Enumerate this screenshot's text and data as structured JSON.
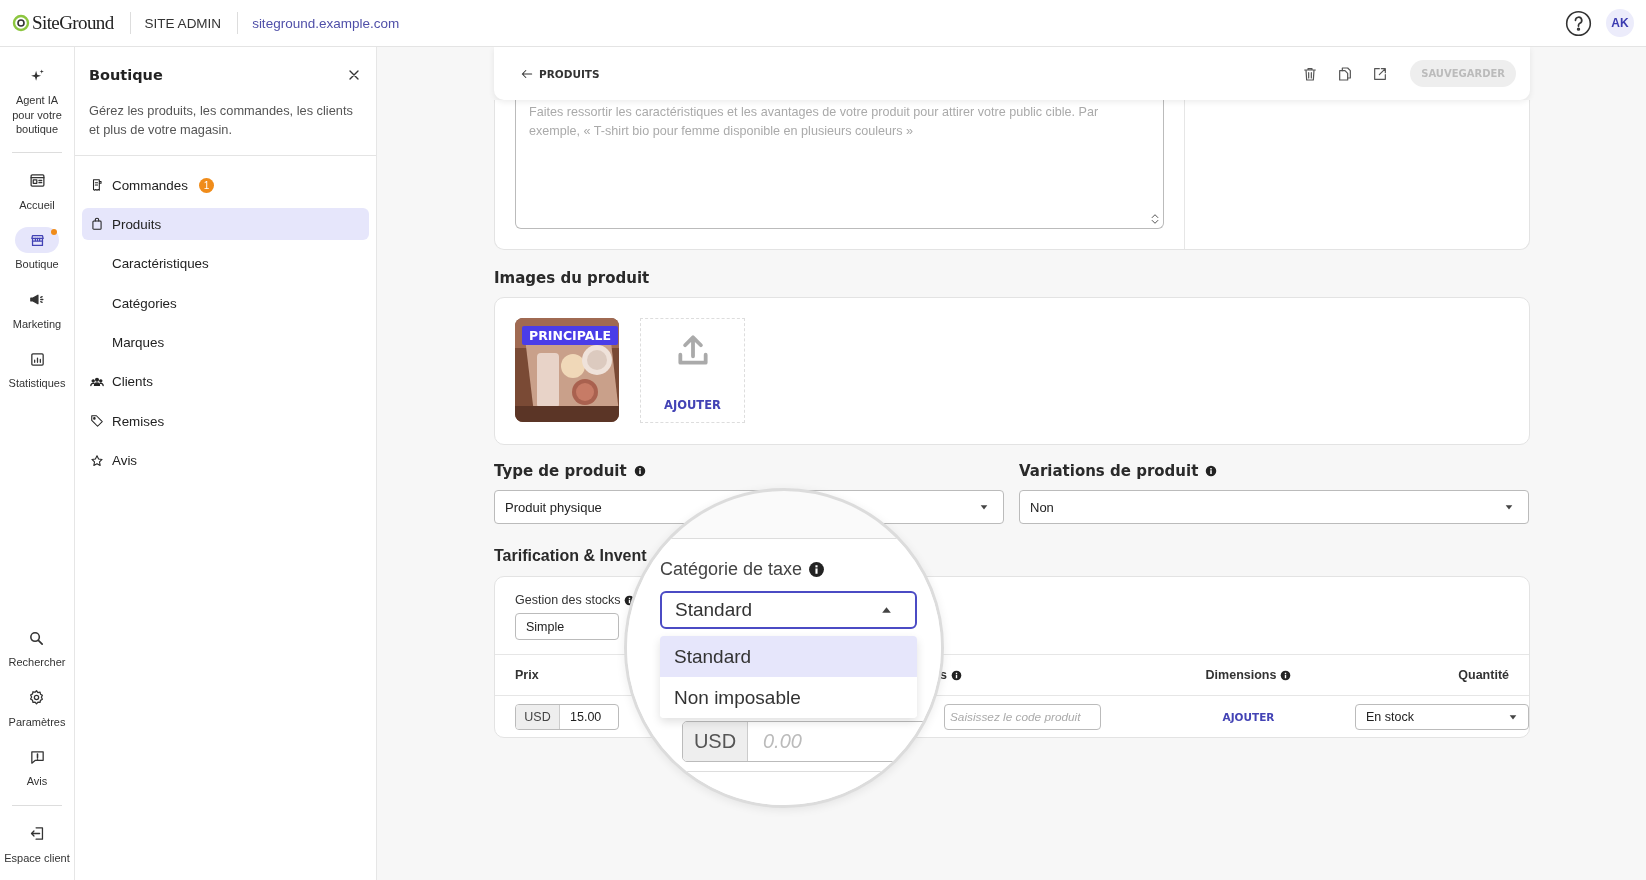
{
  "top_bar": {
    "logo": "SiteGround",
    "section": "SITE ADMIN",
    "site": "siteground.example.com",
    "avatar": "AK"
  },
  "rail": {
    "items": [
      {
        "label": "Agent IA pour votre boutique",
        "selected": false,
        "notification": false
      },
      {
        "label": "Accueil",
        "selected": false,
        "notification": false
      },
      {
        "label": "Boutique",
        "selected": true,
        "notification": true
      },
      {
        "label": "Marketing",
        "selected": false,
        "notification": false
      },
      {
        "label": "Statistiques",
        "selected": false,
        "notification": false
      }
    ],
    "bottom_items": [
      {
        "label": "Rechercher",
        "selected": false
      },
      {
        "label": "Paramètres",
        "selected": false
      },
      {
        "label": "Avis",
        "selected": false
      }
    ],
    "exit": {
      "label": "Espace client"
    }
  },
  "panel": {
    "title": "Boutique",
    "description": "Gérez les produits, les commandes, les clients et plus de votre magasin.",
    "items": [
      {
        "label": "Commandes",
        "badge": "1",
        "selected": false
      },
      {
        "label": "Produits",
        "selected": true,
        "children": [
          {
            "label": "Caractéristiques",
            "selected": false
          },
          {
            "label": "Catégories",
            "selected": false
          },
          {
            "label": "Marques",
            "selected": false
          }
        ]
      },
      {
        "label": "Clients",
        "selected": false
      },
      {
        "label": "Remises",
        "selected": false
      },
      {
        "label": "Avis",
        "selected": false
      }
    ]
  },
  "header": {
    "back": "PRODUITS",
    "save": {
      "label": "SAUVEGARDER",
      "disabled": true
    }
  },
  "description": {
    "placeholder": "Faites ressortir les caractéristiques et les avantages de votre produit pour attirer votre public cible. Par exemple, « T-shirt bio pour femme disponible en plusieurs couleurs »"
  },
  "images": {
    "title": "Images du produit",
    "items": [
      {
        "kind": "picture",
        "badge": "PRINCIPALE"
      },
      {
        "kind": "upload",
        "label": "AJOUTER"
      }
    ]
  },
  "product_type": {
    "label": "Type de produit",
    "value": "Produit physique"
  },
  "variations": {
    "label": "Variations de produit",
    "value": "Non"
  },
  "pricing": {
    "title": "Tarification & Invent",
    "stock_label": "Gestion des stocks",
    "stock_value": "Simple",
    "columns": [
      {
        "label": "Prix",
        "info": false
      },
      {
        "label": "s",
        "info": true
      },
      {
        "label": "Dimensions",
        "info": true
      },
      {
        "label": "Quantité",
        "info": false
      }
    ],
    "row": {
      "currency": "USD",
      "price": "15.00",
      "code_placeholder": "Saisissez le code produit",
      "dimensions": "AJOUTER",
      "quantity": "En stock"
    }
  },
  "magnifier": {
    "label": "Catégorie de taxe",
    "value": "Standard",
    "expanded": true,
    "options": [
      {
        "label": "Standard",
        "selected": true
      },
      {
        "label": "Non imposable",
        "selected": false
      }
    ],
    "currency": "USD",
    "price_placeholder": "0.00"
  }
}
